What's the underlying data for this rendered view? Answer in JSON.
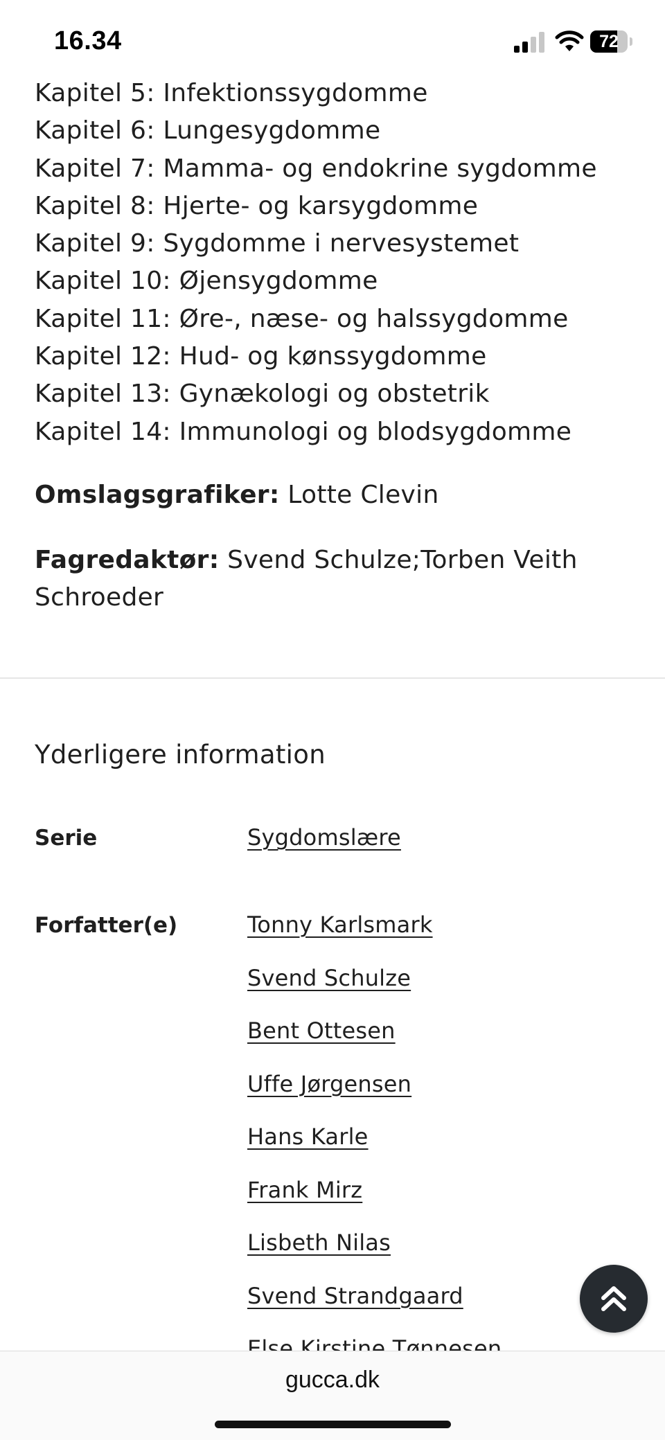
{
  "status_bar": {
    "time": "16.34",
    "battery_level": 72,
    "battery_text": "72",
    "icons": [
      "signal-icon",
      "wifi-icon",
      "battery-icon"
    ]
  },
  "chapters": [
    "Kapitel 5: Infektionssygdomme",
    "Kapitel 6: Lungesygdomme",
    "Kapitel 7: Mamma- og endokrine sygdomme",
    "Kapitel 8: Hjerte- og karsygdomme",
    "Kapitel 9: Sygdomme i nervesystemet",
    "Kapitel 10: Øjensygdomme",
    "Kapitel 11: Øre-, næse- og halssygdomme",
    "Kapitel 12: Hud- og kønssygdomme",
    "Kapitel 13: Gynækologi og obstetrik",
    "Kapitel 14: Immunologi og blodsygdomme"
  ],
  "cover": {
    "label": "Omslagsgrafiker:",
    "value": "Lotte Clevin"
  },
  "editor": {
    "label": "Fagredaktør:",
    "value": "Svend Schulze;Torben Veith Schroeder"
  },
  "more_info": {
    "title": "Yderligere information",
    "series_label": "Serie",
    "series_value": "Sygdomslære",
    "authors_label": "Forfatter(e)",
    "authors": [
      "Tonny Karlsmark",
      "Svend Schulze",
      "Bent Ottesen",
      "Uffe Jørgensen",
      "Hans Karle",
      "Frank Mirz",
      "Lisbeth Nilas",
      "Svend Strandgaard",
      "Else Kirstine Tønnesen"
    ]
  },
  "browser": {
    "url": "gucca.dk"
  },
  "colors": {
    "text": "#1f1f1f",
    "scroll_button": "#262b30",
    "divider": "#e6e6e6"
  }
}
